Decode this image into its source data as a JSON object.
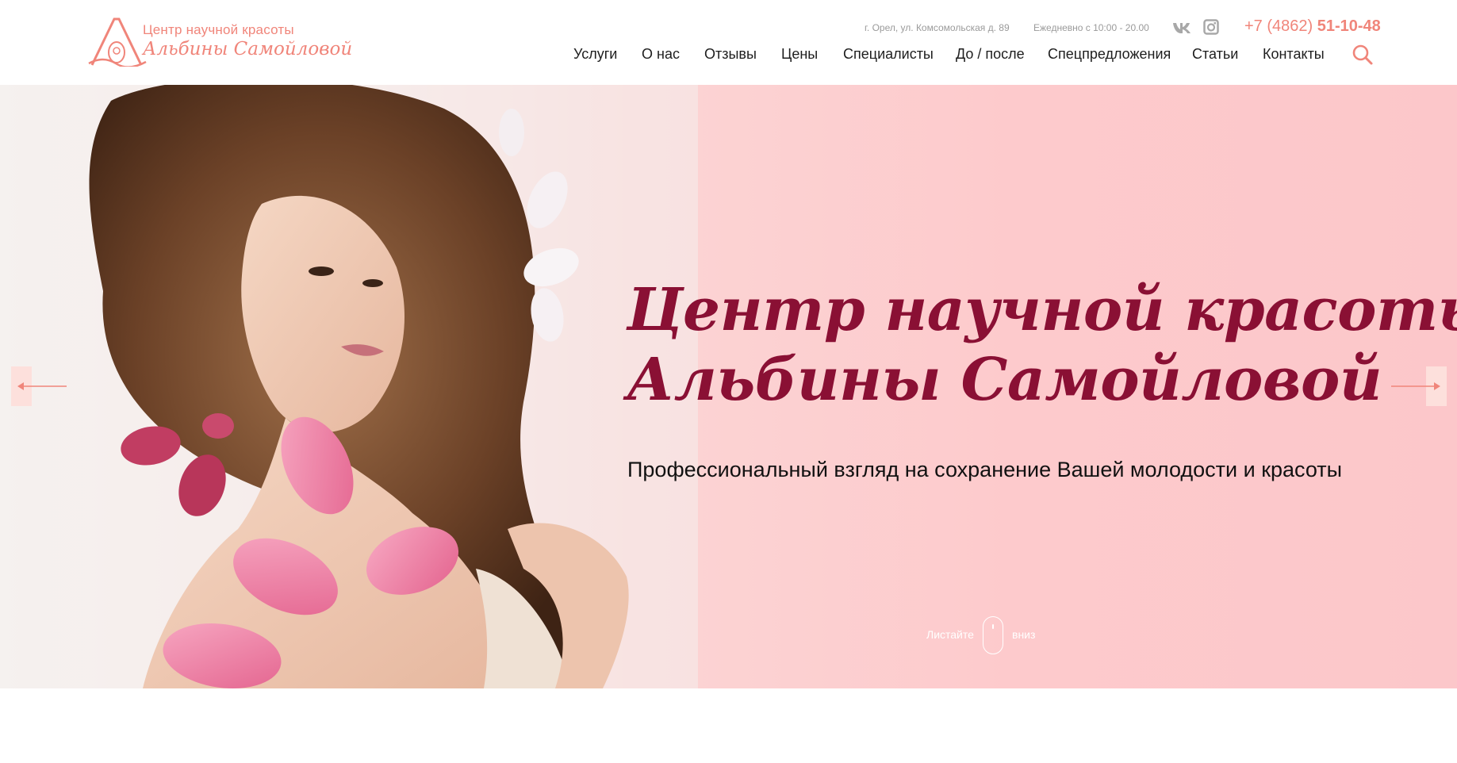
{
  "header": {
    "logo": {
      "line1": "Центр научной красоты",
      "line2": "Альбины Самойловой"
    },
    "address": "г. Орел, ул. Комсомольская д. 89",
    "hours": "Ежедневно с 10:00 - 20.00",
    "social": [
      {
        "name": "vk",
        "icon": "vk-icon"
      },
      {
        "name": "instagram",
        "icon": "instagram-icon"
      }
    ],
    "phone": {
      "prefix": "+7 (4862) ",
      "number": "51-10-48"
    },
    "nav": [
      {
        "label": "Услуги"
      },
      {
        "label": "О нас"
      },
      {
        "label": "Отзывы"
      },
      {
        "label": "Цены"
      },
      {
        "label": "Специалисты"
      },
      {
        "label": "До / после"
      },
      {
        "label": "Спецпредложения"
      },
      {
        "label": "Статьи"
      },
      {
        "label": "Контакты"
      }
    ],
    "search_icon": "search-icon"
  },
  "hero": {
    "title_line1": "Центр научной красоты",
    "title_line2": "Альбины Самойловой",
    "subtitle": "Профессиональный взгляд на сохранение Вашей молодости и красоты",
    "scroll_left": "Листайте",
    "scroll_right": "вниз"
  },
  "colors": {
    "accent": "#f0857a",
    "title": "#8a1034",
    "hero_bg": "#fcd0d1"
  }
}
